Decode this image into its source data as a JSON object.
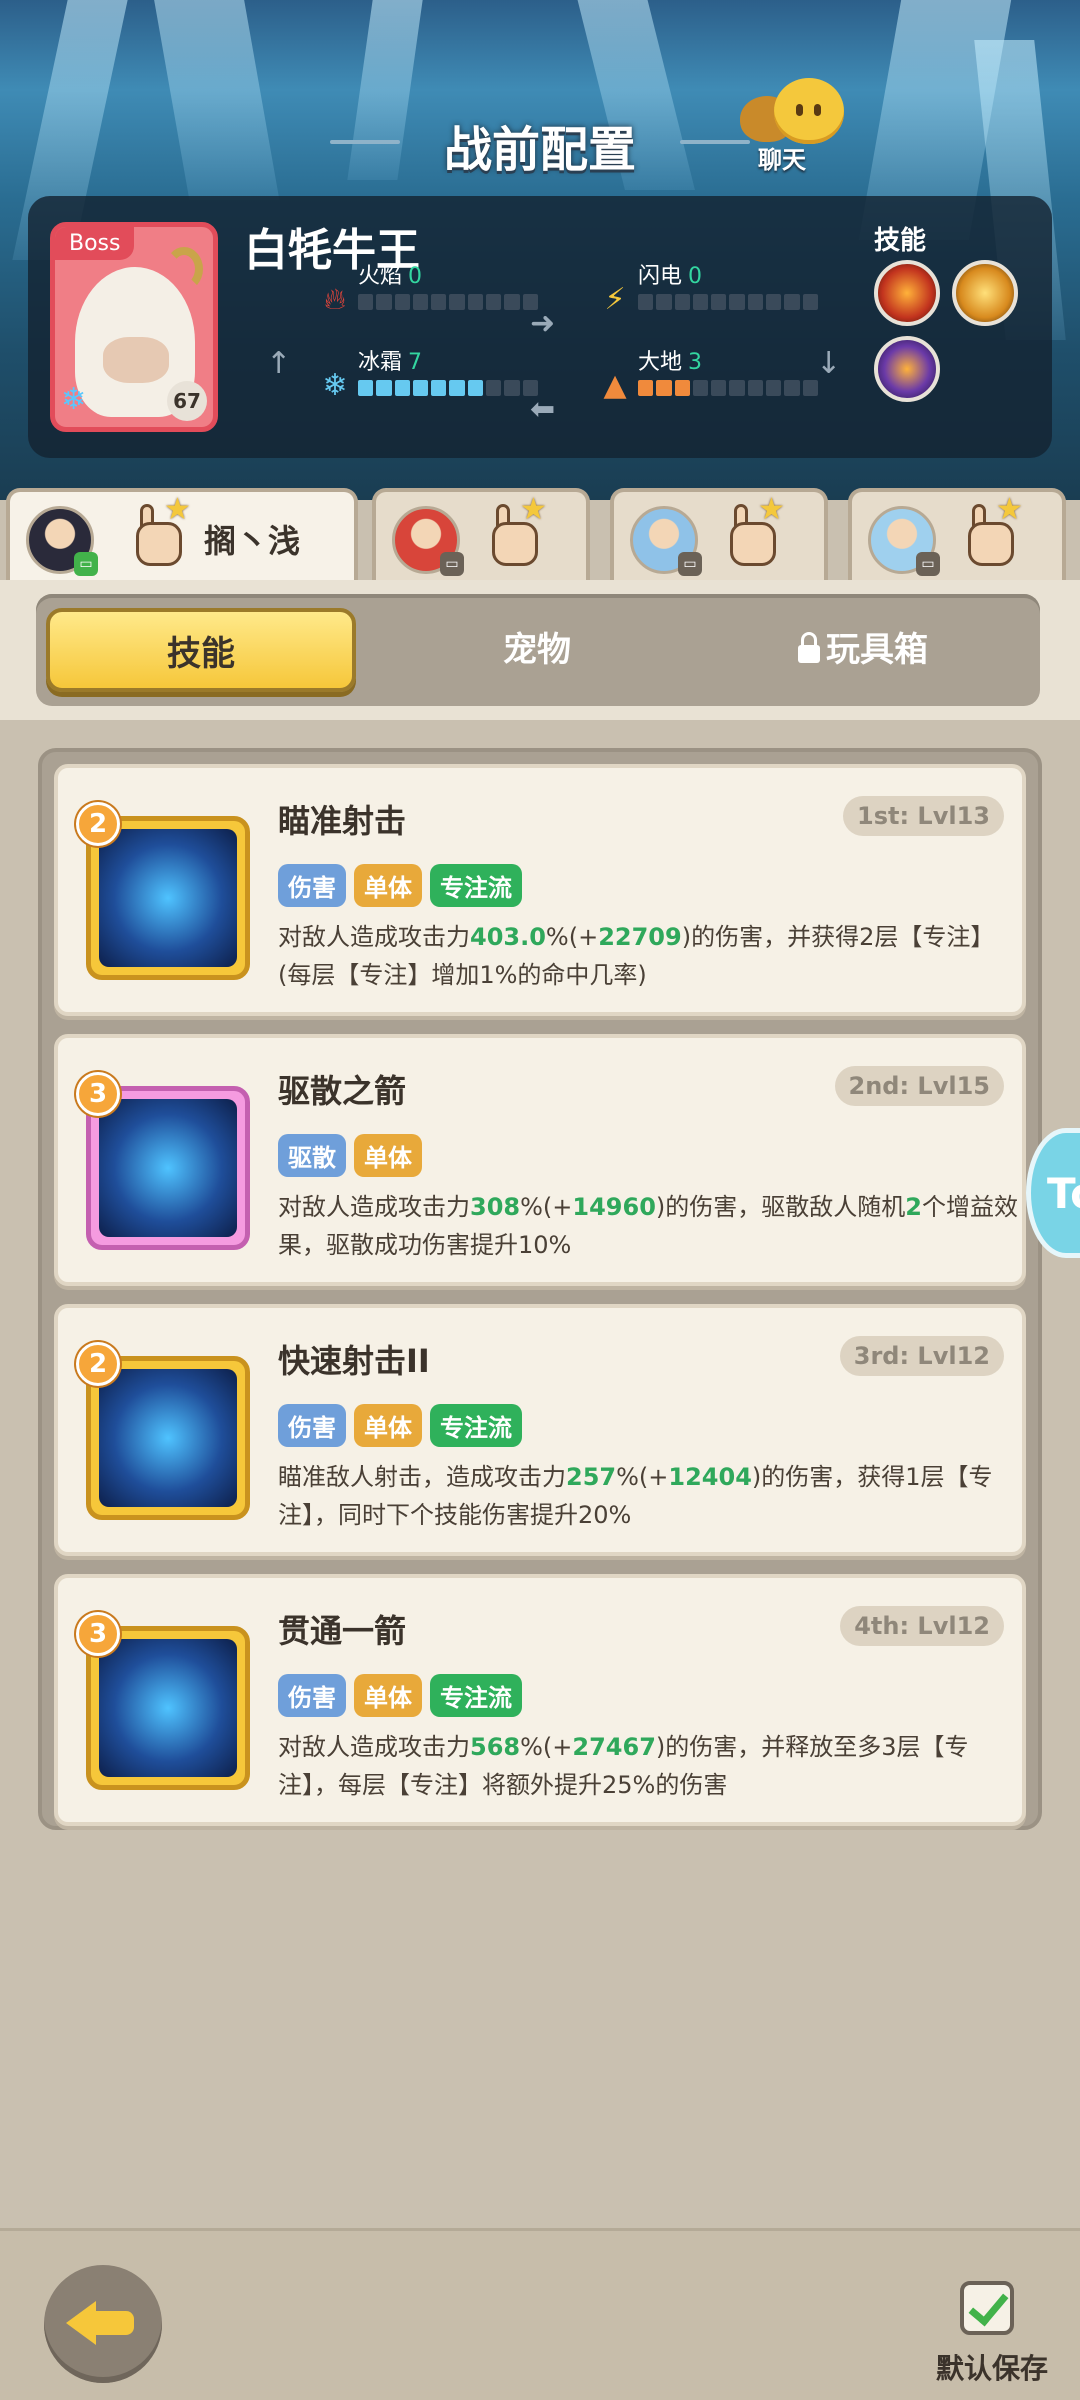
{
  "header": {
    "title": "战前配置",
    "chat_label": "聊天"
  },
  "boss": {
    "tag": "Boss",
    "name": "白牦牛王",
    "level": "67",
    "skills_label": "技能",
    "stats": [
      {
        "name": "火焰",
        "value": "0",
        "fill": 0,
        "color": "#e8453a",
        "icon": "fire-icon"
      },
      {
        "name": "闪电",
        "value": "0",
        "fill": 0,
        "color": "#f4c83c",
        "icon": "lightning-icon"
      },
      {
        "name": "冰霜",
        "value": "7",
        "fill": 7,
        "color": "#66c9f0",
        "icon": "snowflake-icon"
      },
      {
        "name": "大地",
        "value": "3",
        "fill": 3,
        "color": "#f08a3c",
        "icon": "earth-icon"
      }
    ]
  },
  "heroes": [
    {
      "name": "搁丶浅",
      "active": true
    },
    {
      "name": "",
      "active": false
    },
    {
      "name": "",
      "active": false
    },
    {
      "name": "",
      "active": false
    }
  ],
  "tabs": {
    "skills": "技能",
    "pets": "宠物",
    "toybox": "玩具箱"
  },
  "skills": [
    {
      "cost": "2",
      "name": "瞄准射击",
      "level": "1st: Lvl13",
      "frame": "gold",
      "tags": [
        "伤害",
        "单体",
        "专注流"
      ],
      "desc_parts": [
        "对敌人造成攻击力",
        "403.0",
        "%(+",
        "22709",
        ")的伤害，并获得2层【专注】(每层【专注】增加1%的命中几率)"
      ]
    },
    {
      "cost": "3",
      "name": "驱散之箭",
      "level": "2nd: Lvl15",
      "frame": "pink",
      "tags": [
        "驱散",
        "单体"
      ],
      "desc_parts": [
        "对敌人造成攻击力",
        "308",
        "%(+",
        "14960",
        ")的伤害，驱散敌人随机",
        "2",
        "个增益效果，驱散成功伤害提升10%"
      ]
    },
    {
      "cost": "2",
      "name": "快速射击II",
      "level": "3rd: Lvl12",
      "frame": "gold",
      "tags": [
        "伤害",
        "单体",
        "专注流"
      ],
      "desc_parts": [
        "瞄准敌人射击，造成攻击力",
        "257",
        "%(+",
        "12404",
        ")的伤害，获得1层【专注】，同时下个技能伤害提升20%"
      ]
    },
    {
      "cost": "3",
      "name": "贯通一箭",
      "level": "4th: Lvl12",
      "frame": "gold",
      "tags": [
        "伤害",
        "单体",
        "专注流"
      ],
      "desc_parts": [
        "对敌人造成攻击力",
        "568",
        "%(+",
        "27467",
        ")的伤害，并释放至多3层【专注】，每层【专注】将额外提升25%的伤害"
      ]
    }
  ],
  "side_handle": "To",
  "footer": {
    "save_label": "默认保存"
  }
}
